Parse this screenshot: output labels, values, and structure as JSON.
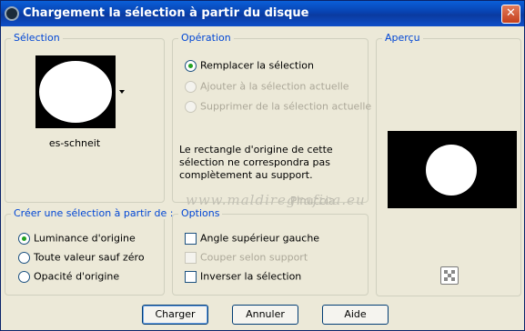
{
  "window": {
    "title": "Chargement la sélection à partir du disque",
    "close_label": "✕"
  },
  "selection_group": {
    "legend": "Sélection",
    "thumbnail_name": "es-schneit"
  },
  "operation_group": {
    "legend": "Opération",
    "options": [
      {
        "label": "Remplacer la sélection",
        "checked": true,
        "enabled": true
      },
      {
        "label": "Ajouter à la sélection actuelle",
        "checked": false,
        "enabled": false
      },
      {
        "label": "Supprimer de la sélection actuelle",
        "checked": false,
        "enabled": false
      }
    ],
    "note": "Le rectangle d'origine de cette sélection ne correspondra pas complètement au support."
  },
  "preview_group": {
    "legend": "Aperçu"
  },
  "create_group": {
    "legend": "Créer une sélection à partir de :",
    "options": [
      {
        "label": "Luminance d'origine",
        "checked": true
      },
      {
        "label": "Toute valeur sauf zéro",
        "checked": false
      },
      {
        "label": "Opacité d'origine",
        "checked": false
      }
    ]
  },
  "options_group": {
    "legend": "Options",
    "items": [
      {
        "label": "Angle supérieur gauche",
        "checked": false,
        "enabled": true
      },
      {
        "label": "Couper selon support",
        "checked": false,
        "enabled": false
      },
      {
        "label": "Inverser la sélection",
        "checked": false,
        "enabled": true
      }
    ]
  },
  "watermark": {
    "line1": "Pinuccia",
    "line2": "www.maldiregrafica.eu"
  },
  "buttons": {
    "load": "Charger",
    "cancel": "Annuler",
    "help": "Aide"
  }
}
